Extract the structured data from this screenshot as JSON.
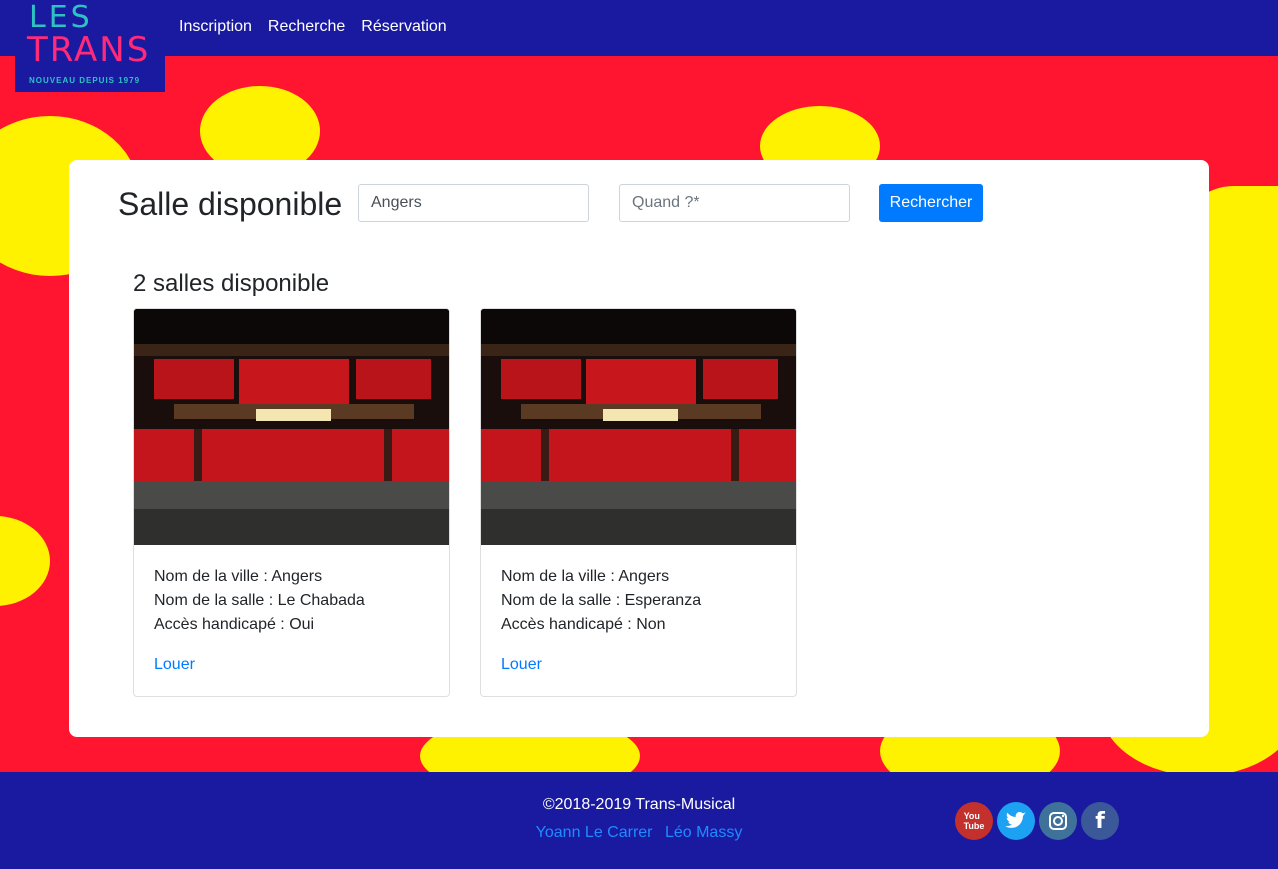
{
  "brand": {
    "line1": "LES",
    "line2": "TRANS",
    "tagline": "NOUVEAU DEPUIS 1979"
  },
  "nav": {
    "items": [
      "Inscription",
      "Recherche",
      "Réservation"
    ]
  },
  "search": {
    "title": "Salle disponible",
    "city_value": "Angers",
    "when_placeholder": "Quand ?*",
    "button_label": "Rechercher"
  },
  "results": {
    "count_label": "2 salles disponible",
    "cards": [
      {
        "ville": "Nom de la ville : Angers",
        "salle": "Nom de la salle : Le Chabada",
        "acces": "Accès handicapé : Oui",
        "action": "Louer"
      },
      {
        "ville": "Nom de la ville : Angers",
        "salle": "Nom de la salle : Esperanza",
        "acces": "Accès handicapé : Non",
        "action": "Louer"
      }
    ]
  },
  "footer": {
    "copyright": "©2018-2019 Trans-Musical",
    "authors": [
      "Yoann Le Carrer",
      "Léo Massy"
    ],
    "socials": [
      {
        "icon": "youtube-icon",
        "color": "#c4302b"
      },
      {
        "icon": "twitter-icon",
        "color": "#1da1f2"
      },
      {
        "icon": "instagram-icon",
        "color": "#3f729b"
      },
      {
        "icon": "facebook-icon",
        "color": "#3b5998"
      }
    ]
  },
  "colors": {
    "navy": "#1a1aa0",
    "red": "#ff1530",
    "yellow": "#fff200",
    "primary": "#007bff"
  }
}
